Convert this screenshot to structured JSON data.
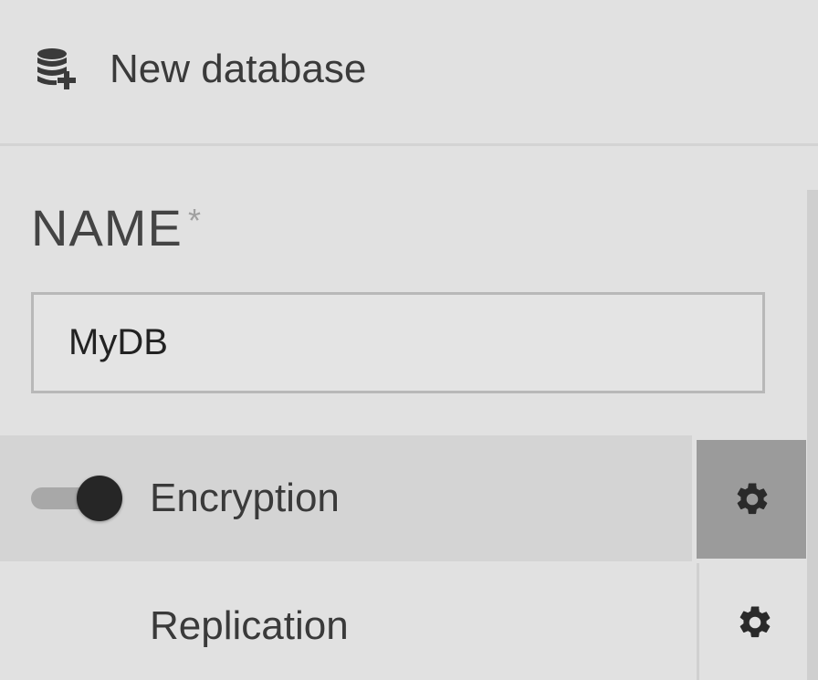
{
  "header": {
    "title": "New database",
    "icon": "database-add-icon"
  },
  "form": {
    "name_label": "NAME",
    "required_mark": "*",
    "name_value": "MyDB"
  },
  "options": [
    {
      "label": "Encryption",
      "toggle_visible": true,
      "enabled": true,
      "settings_icon": "gear-icon"
    },
    {
      "label": "Replication",
      "toggle_visible": false,
      "settings_icon": "gear-icon"
    }
  ],
  "colors": {
    "background": "#e1e1e1",
    "selected_row": "#d4d4d4",
    "active_settings_button": "#9b9b9b",
    "toggle_knob": "#262626"
  }
}
